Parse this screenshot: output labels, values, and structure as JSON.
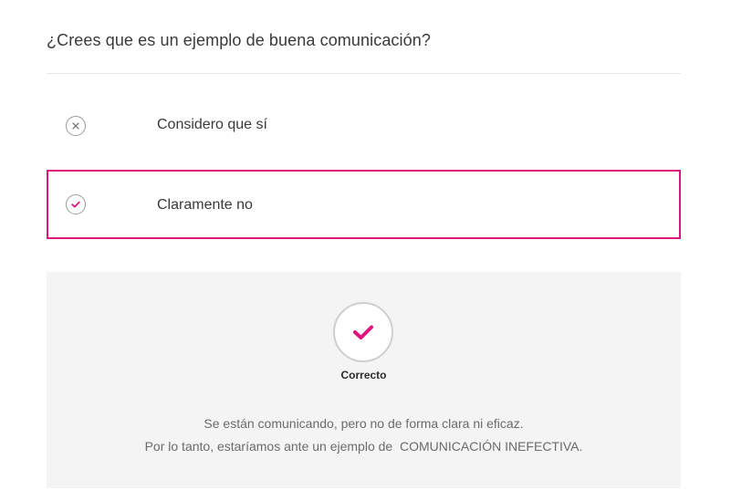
{
  "question": "¿Crees que es un ejemplo de buena comunicación?",
  "options": [
    {
      "label": "Considero que sí",
      "icon": "close-icon",
      "selected": false
    },
    {
      "label": "Claramente no",
      "icon": "check-icon",
      "selected": true
    }
  ],
  "feedback": {
    "status": "Correcto",
    "icon": "check-icon",
    "lines": [
      "Se están comunicando, pero no de forma clara ni eficaz.",
      "Por lo tanto, estaríamos ante un ejemplo de  COMUNICACIÓN INEFECTIVA."
    ]
  },
  "colors": {
    "accent": "#e0157f",
    "text": "#3a3a3a",
    "muted_text": "#6b6b6b",
    "feedback_bg": "#f4f4f4",
    "divider": "#e6e6e6"
  }
}
